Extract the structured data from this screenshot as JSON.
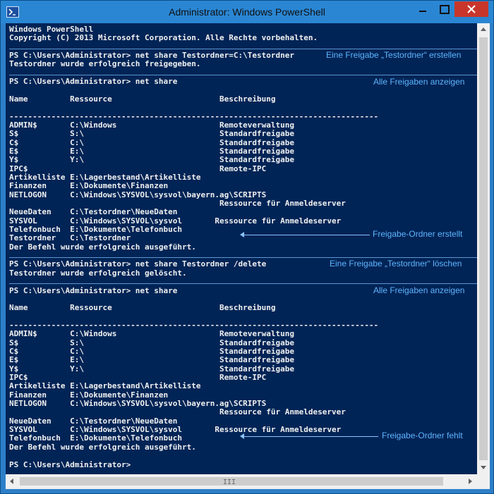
{
  "window": {
    "title": "Administrator: Windows PowerShell",
    "icon": "powershell-icon",
    "controls": [
      "minimize-icon",
      "maximize-icon",
      "close-icon"
    ]
  },
  "colors": {
    "console_background": "#012456",
    "console_text": "#f0f0f0",
    "annotation": "#5fb5ff",
    "titlebar": "#2a86d3",
    "close_button": "#c8362b"
  },
  "console": {
    "lines": [
      "Windows PowerShell",
      "Copyright (C) 2013 Microsoft Corporation. Alle Rechte vorbehalten.",
      "",
      "PS C:\\Users\\Administrator> net share Testordner=C:\\Testordner",
      "Testordner wurde erfolgreich freigegeben.",
      "",
      "PS C:\\Users\\Administrator> net share",
      "",
      "Name         Ressource                       Beschreibung",
      "",
      "-------------------------------------------------------------------------------",
      "ADMIN$       C:\\Windows                      Remoteverwaltung",
      "S$           S:\\                             Standardfreigabe",
      "C$           C:\\                             Standardfreigabe",
      "E$           E:\\                             Standardfreigabe",
      "Y$           Y:\\                             Standardfreigabe",
      "IPC$                                         Remote-IPC",
      "Artikelliste E:\\Lagerbestand\\Artikelliste",
      "Finanzen     E:\\Dokumente\\Finanzen",
      "NETLOGON     C:\\Windows\\SYSVOL\\sysvol\\bayern.ag\\SCRIPTS",
      "                                             Ressource für Anmeldeserver",
      "NeueDaten    C:\\Testordner\\NeueDaten",
      "SYSVOL       C:\\Windows\\SYSVOL\\sysvol       Ressource für Anmeldeserver",
      "Telefonbuch  E:\\Dokumente\\Telefonbuch",
      "Testordner   C:\\Testordner",
      "Der Befehl wurde erfolgreich ausgeführt.",
      "",
      "PS C:\\Users\\Administrator> net share Testordner /delete",
      "Testordner wurde erfolgreich gelöscht.",
      "",
      "PS C:\\Users\\Administrator> net share",
      "",
      "Name         Ressource                       Beschreibung",
      "",
      "-------------------------------------------------------------------------------",
      "ADMIN$       C:\\Windows                      Remoteverwaltung",
      "S$           S:\\                             Standardfreigabe",
      "C$           C:\\                             Standardfreigabe",
      "E$           E:\\                             Standardfreigabe",
      "Y$           Y:\\                             Standardfreigabe",
      "IPC$                                         Remote-IPC",
      "Artikelliste E:\\Lagerbestand\\Artikelliste",
      "Finanzen     E:\\Dokumente\\Finanzen",
      "NETLOGON     C:\\Windows\\SYSVOL\\sysvol\\bayern.ag\\SCRIPTS",
      "                                             Ressource für Anmeldeserver",
      "NeueDaten    C:\\Testordner\\NeueDaten",
      "SYSVOL       C:\\Windows\\SYSVOL\\sysvol       Ressource für Anmeldeserver",
      "Telefonbuch  E:\\Dokumente\\Telefonbuch",
      "Der Befehl wurde erfolgreich ausgeführt.",
      "",
      "PS C:\\Users\\Administrator>"
    ]
  },
  "annotations": {
    "create_share": "Eine Freigabe „Testordner“ erstellen",
    "show_all_1": "Alle Freigaben anzeigen",
    "folder_created": "Freigabe-Ordner erstellt",
    "delete_share": "Eine Freigabe „Testordner“ löschen",
    "show_all_2": "Alle Freigaben anzeigen",
    "folder_missing": "Freigabe-Ordner fehlt"
  },
  "scrollbars": {
    "horizontal_grip": "III"
  }
}
